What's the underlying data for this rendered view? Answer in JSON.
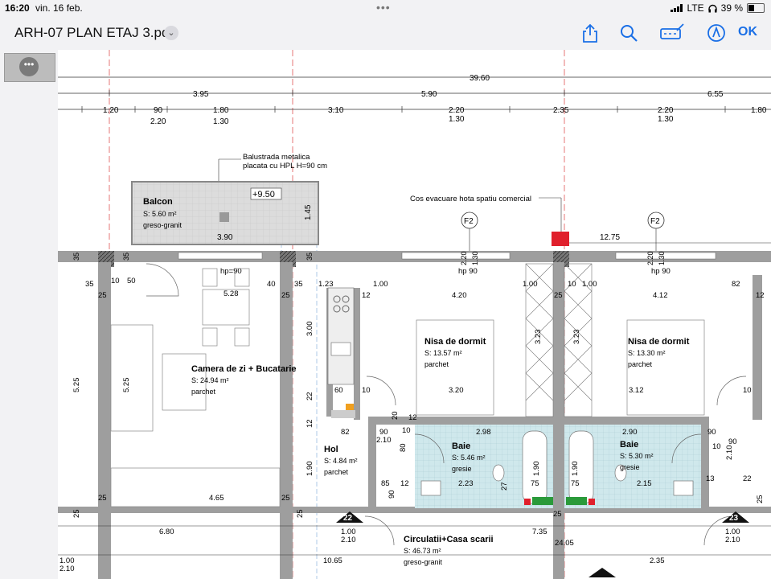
{
  "status_bar": {
    "time": "16:20",
    "date": "vin. 16 feb.",
    "network": "LTE",
    "battery": "39 %"
  },
  "toolbar": {
    "doc_title": "ARH-07 PLAN ETAJ 3.pdf",
    "ok_label": "OK",
    "icons": [
      "share-icon",
      "search-icon",
      "markup-icon",
      "annotate-icon"
    ]
  },
  "colors": {
    "accent": "#1a6fe6",
    "wall": "#9e9e9e",
    "bath_tile": "#cfe8ec",
    "axis": "#e05555",
    "marker_red": "#e0202c"
  },
  "plan": {
    "dims_top": {
      "total": "39.60",
      "seg1": "3.95",
      "seg2": "5.90",
      "seg3": "6.55"
    },
    "dims_row3": [
      "1.20",
      "90",
      "1.80",
      "3.10",
      "2.20",
      "2.35",
      "2.20",
      "1.80"
    ],
    "dims_row4": [
      "2.20",
      "1.30",
      "1.30",
      "1.30"
    ],
    "balustrade_note": [
      "Balustrada metalica",
      "placata cu HPL H=90 cm"
    ],
    "hood_note": "Cos evacuare hota spatiu comercial",
    "elevation": "+9.50",
    "axis_labels": [
      "F2",
      "F2",
      "22",
      "23"
    ],
    "rooms": [
      {
        "name": "Balcon",
        "area": "S: 5.60 m²",
        "finish": "greso-granit"
      },
      {
        "name": "Camera de zi + Bucatarie",
        "area": "S: 24.94 m²",
        "finish": "parchet"
      },
      {
        "name": "Nisa de dormit",
        "area": "S: 13.57 m²",
        "finish": "parchet"
      },
      {
        "name": "Nisa de dormit",
        "area": "S: 13.30 m²",
        "finish": "parchet"
      },
      {
        "name": "Hol",
        "area": "S: 4.84 m²",
        "finish": "parchet"
      },
      {
        "name": "Baie",
        "area": "S: 5.46 m²",
        "finish": "gresie"
      },
      {
        "name": "Baie",
        "area": "S: 5.30 m²",
        "finish": "gresie"
      },
      {
        "name": "Circulatii+Casa scarii",
        "area": "S: 46.73 m²",
        "finish": "greso-granit"
      }
    ],
    "small_dims": {
      "d1275": "12.75",
      "d390": "3.90",
      "d145": "1.45",
      "hp90a": "hp=90",
      "hp90b": "hp 90",
      "hp90c": "hp 90",
      "d220a": "2.20",
      "d130a": "1.30",
      "d220b": "2.20",
      "d130b": "1.30",
      "d35a": "35",
      "d10a": "10",
      "d50": "50",
      "d528": "5.28",
      "d40": "40",
      "d35b": "35",
      "d123": "1.23",
      "d100a": "1.00",
      "d100b": "1.00",
      "d10b": "10",
      "d100c": "1.00",
      "d82a": "82",
      "d25a": "25",
      "d25b": "25",
      "d12a": "12",
      "d420": "4.20",
      "d25c": "25",
      "d412": "4.12",
      "d12b": "12",
      "d300": "3.00",
      "d323a": "3.23",
      "d323b": "3.23",
      "d525a": "5.25",
      "d525b": "5.25",
      "d60": "60",
      "d10c": "10",
      "d225a": "22",
      "d320": "3.20",
      "d312": "3.12",
      "d10d": "10",
      "d82b": "82",
      "d298": "2.98",
      "d290": "2.90",
      "d20": "20",
      "d12c": "12",
      "d12d": "12",
      "d90a": "90",
      "d210a": "2.10",
      "d10e": "10",
      "d90b": "90",
      "d10f": "10",
      "d210b": "2.10",
      "d90c": "90",
      "d190a": "1.90",
      "d190b": "1.90",
      "d190c": "1.90",
      "d85": "85",
      "d12e": "12",
      "d223": "2.23",
      "d275": "27",
      "d75a": "75",
      "d75b": "75",
      "d215": "2.15",
      "d13": "13",
      "d225b": "22",
      "d465": "4.65",
      "d680": "6.80",
      "d735": "7.35",
      "d2405": "24.05",
      "d100d": "1.00",
      "d210c": "2.10",
      "d100e": "1.00",
      "d210d": "2.10",
      "d1065": "10.65",
      "d100f": "1.00",
      "d210e": "2.10",
      "d235": "2.35",
      "d25d": "25",
      "d25e": "25",
      "d25f": "25",
      "d25g": "25",
      "d25h": "25",
      "d25i": "25",
      "d90d": "90",
      "d80": "80",
      "d35c": "35",
      "d35d": "35",
      "d35e": "35"
    }
  }
}
